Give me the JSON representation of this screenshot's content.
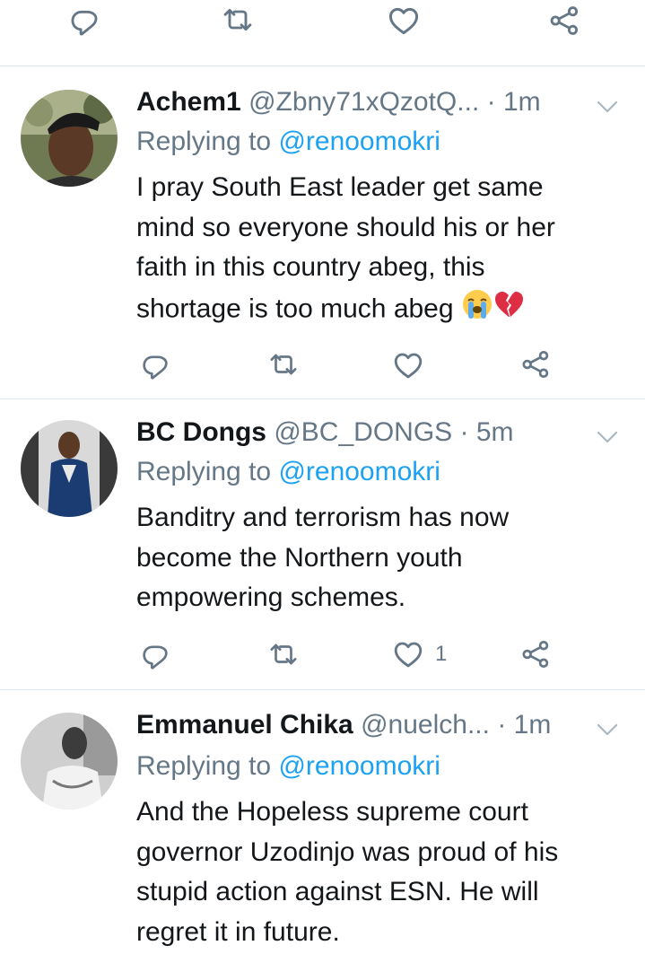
{
  "icons": {
    "reply": "reply-icon",
    "retweet": "retweet-icon",
    "like": "heart-icon",
    "share": "share-icon",
    "more": "chevron-down-icon",
    "emoji_cry": "loudly-crying-face-emoji",
    "emoji_broken_heart": "broken-heart-emoji"
  },
  "colors": {
    "icon_gray": "#657786",
    "link_blue": "#1da1f2",
    "text": "#14171a",
    "divider": "#e1e8ed"
  },
  "tweets": [
    {
      "name": "Achem1",
      "handle": "@Zbny71xQzotQ...",
      "time": "· 1m",
      "replying_prefix": "Replying to",
      "replying_to": "@renoomokri",
      "lines": [
        "I pray South East leader get same",
        "mind so everyone should his or her",
        "faith in this country abeg, this",
        "shortage is too much abeg"
      ],
      "like_count": ""
    },
    {
      "name": "BC Dongs",
      "handle": "@BC_DONGS",
      "time": "· 5m",
      "replying_prefix": "Replying to",
      "replying_to": "@renoomokri",
      "lines": [
        "Banditry and terrorism has now",
        "become the Northern youth",
        "empowering schemes."
      ],
      "like_count": "1"
    },
    {
      "name": "Emmanuel Chika",
      "handle": "@nuelch...",
      "time": "· 1m",
      "replying_prefix": "Replying to",
      "replying_to": "@renoomokri",
      "lines": [
        "And the Hopeless supreme court",
        "governor Uzodinjo was proud of his",
        "stupid action against ESN. He will",
        "regret it in future."
      ],
      "like_count": ""
    }
  ]
}
